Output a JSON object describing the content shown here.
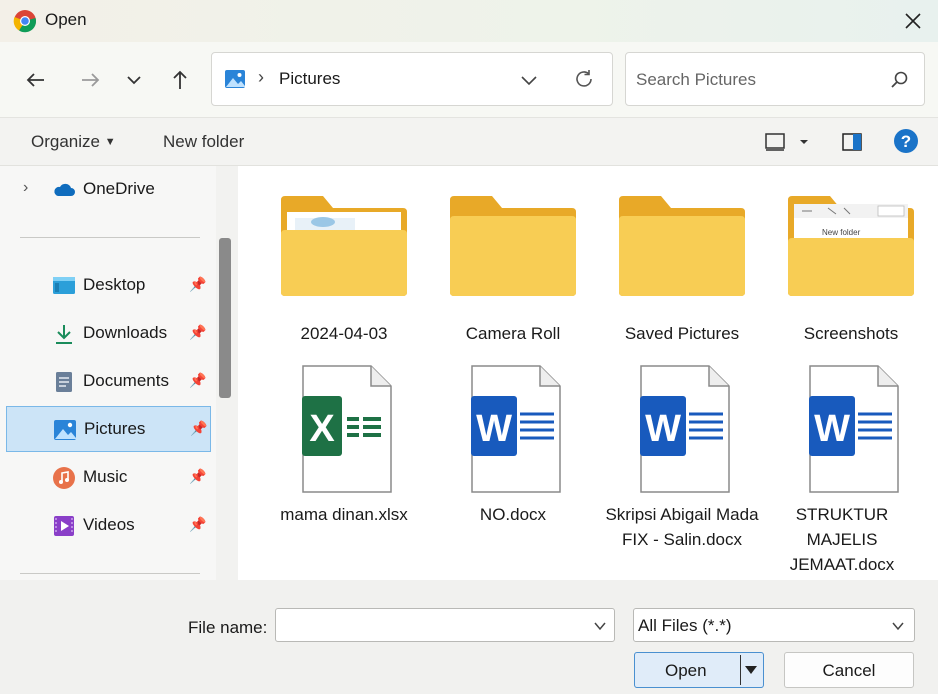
{
  "window": {
    "title": "Open"
  },
  "navigation": {
    "address": {
      "crumb": "Pictures"
    },
    "search": {
      "placeholder": "Search Pictures"
    }
  },
  "toolbar": {
    "organize_label": "Organize",
    "new_folder_label": "New folder"
  },
  "sidebar": {
    "items": [
      {
        "label": "OneDrive",
        "icon": "cloud-icon"
      },
      {
        "label": "Desktop",
        "icon": "desktop-icon"
      },
      {
        "label": "Downloads",
        "icon": "download-arrow-icon"
      },
      {
        "label": "Documents",
        "icon": "document-icon"
      },
      {
        "label": "Pictures",
        "icon": "picture-icon",
        "selected": true
      },
      {
        "label": "Music",
        "icon": "music-icon"
      },
      {
        "label": "Videos",
        "icon": "video-icon"
      }
    ]
  },
  "files": [
    {
      "name": "2024-04-03",
      "kind": "folder"
    },
    {
      "name": "Camera Roll",
      "kind": "folder"
    },
    {
      "name": "Saved Pictures",
      "kind": "folder"
    },
    {
      "name": "Screenshots",
      "kind": "folder"
    },
    {
      "name": "mama dinan.xlsx",
      "kind": "excel"
    },
    {
      "name": "NO.docx",
      "kind": "word"
    },
    {
      "name": "Skripsi Abigail Mada FIX - Salin.docx",
      "kind": "word"
    },
    {
      "name": "STRUKTUR MAJELIS JEMAAT.docx",
      "kind": "word"
    }
  ],
  "folder_previews": {
    "screenshots_text": "New folder"
  },
  "footer": {
    "file_name_label": "File name:",
    "file_name_value": "",
    "file_type_value": "All Files (*.*)",
    "open_label": "Open",
    "cancel_label": "Cancel"
  },
  "colors": {
    "accent": "#0067c0",
    "selected_bg": "#cce4f7",
    "folder": "#f7c948",
    "excel": "#1e7145",
    "word": "#185abd"
  }
}
